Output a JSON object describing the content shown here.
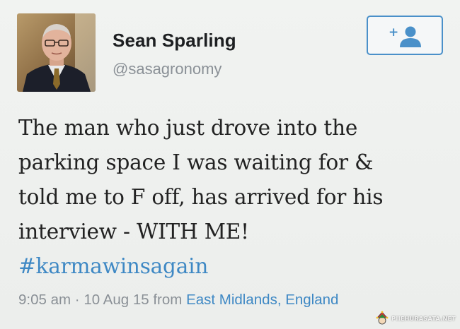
{
  "user": {
    "display_name": "Sean Sparling",
    "handle": "@sasagronomy"
  },
  "follow_button": {
    "icon": "add-user-icon",
    "symbol": "+"
  },
  "tweet": {
    "lines": [
      "The man who just drove into the",
      "parking space I was waiting for &",
      "told me to F off, has arrived for his",
      "interview - WITH ME!"
    ],
    "hashtag": "#karmawinsagain"
  },
  "meta": {
    "time": "9:05 am",
    "separator": "·",
    "date": "10 Aug 15",
    "from_label": "from",
    "location": "East Midlands, England"
  },
  "watermark": {
    "text": "PIIEHURASATA.NET"
  },
  "colors": {
    "link": "#3e88c4",
    "follow_border": "#4a90c9",
    "secondary_text": "#8a9096",
    "background": "#eef1ef"
  }
}
